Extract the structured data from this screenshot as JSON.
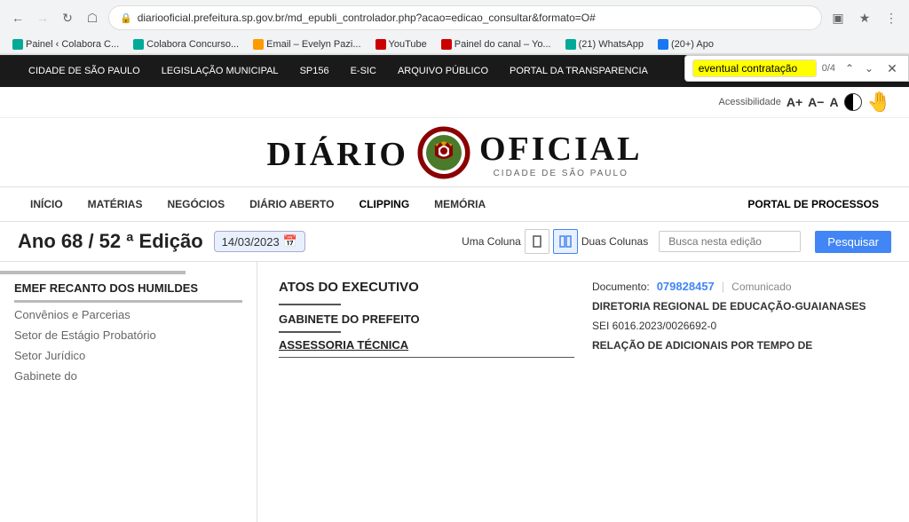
{
  "browser": {
    "url": "diariooficial.prefeitura.sp.gov.br/md_epubli_controlador.php?acao=edicao_consultar&formato=O#",
    "back_disabled": false,
    "forward_disabled": true,
    "find_query": "eventual contratação",
    "find_count": "0/4"
  },
  "bookmarks": [
    {
      "id": "painel-colabora",
      "label": "Painel ‹ Colabora C...",
      "color": "green"
    },
    {
      "id": "colabora-concurso",
      "label": "Colabora Concurso...",
      "color": "green"
    },
    {
      "id": "email-evelyn",
      "label": "Email – Evelyn Pazi...",
      "color": "orange"
    },
    {
      "id": "youtube",
      "label": "YouTube",
      "color": "red"
    },
    {
      "id": "painel-canal",
      "label": "Painel do canal – Yo...",
      "color": "red"
    },
    {
      "id": "whatsapp",
      "label": "(21) WhatsApp",
      "color": "green"
    },
    {
      "id": "facebook",
      "label": "(20+) Apo",
      "color": "blue2"
    }
  ],
  "site_top_nav": [
    {
      "id": "cidade-sp",
      "label": "CIDADE DE SÃO PAULO"
    },
    {
      "id": "legislacao",
      "label": "LEGISLAÇÃO MUNICIPAL"
    },
    {
      "id": "sp156",
      "label": "SP156"
    },
    {
      "id": "esic",
      "label": "E-SIC"
    },
    {
      "id": "arquivo",
      "label": "ARQUIVO PÚBLICO"
    },
    {
      "id": "transparencia",
      "label": "PORTAL DA TRANSPARENCIA"
    }
  ],
  "accessibility": {
    "label": "Acessibilidade",
    "a_plus": "A+",
    "a_minus": "A−",
    "a_normal": "A"
  },
  "logo": {
    "title": "DIÁRIO OFICIAL",
    "subtitle": "CIDADE DE SÃO PAULO"
  },
  "main_nav": [
    {
      "id": "inicio",
      "label": "INÍCIO"
    },
    {
      "id": "materias",
      "label": "MATÉRIAS"
    },
    {
      "id": "negocios",
      "label": "NEGÓCIOS"
    },
    {
      "id": "diario-aberto",
      "label": "DIÁRIO ABERTO"
    },
    {
      "id": "clipping",
      "label": "CLIPPING"
    },
    {
      "id": "memoria",
      "label": "MEMÓRIA"
    },
    {
      "id": "portal-processos",
      "label": "PORTAL DE PROCESSOS",
      "right": true
    }
  ],
  "edition": {
    "title": "Ano 68 / 52 ª Edição",
    "date": "14/03/2023",
    "view_uma_coluna": "Uma Coluna",
    "view_duas_colunas": "Duas Colunas",
    "search_placeholder": "Busca nesta edição",
    "search_btn": "Pesquisar"
  },
  "sidebar": {
    "items": [
      {
        "id": "emef-recanto",
        "label": "EMEF RECANTO DOS HUMILDES",
        "bold": true
      },
      {
        "id": "convenios",
        "label": "Convênios e Parcerias",
        "bold": false
      },
      {
        "id": "estagio",
        "label": "Setor de Estágio Probatório",
        "bold": false
      },
      {
        "id": "juridico",
        "label": "Setor Jurídico",
        "bold": false
      },
      {
        "id": "gabinete",
        "label": "Gabinete do",
        "bold": false
      }
    ]
  },
  "main_content": {
    "section": "ATOS DO EXECUTIVO",
    "subsection_divider_visible": true,
    "gabinete": "GABINETE DO PREFEITO",
    "assessoria": "ASSESSORIA TÉCNICA",
    "right_col": {
      "doc_label": "Documento:",
      "doc_number": "079828457",
      "doc_type": "Comunicado",
      "line1": "DIRETORIA REGIONAL DE EDUCAÇÃO-GUAIANASES",
      "line2": "SEI 6016.2023/0026692-0",
      "line3": "RELAÇÃO DE ADICIONAIS POR TEMPO DE"
    }
  }
}
